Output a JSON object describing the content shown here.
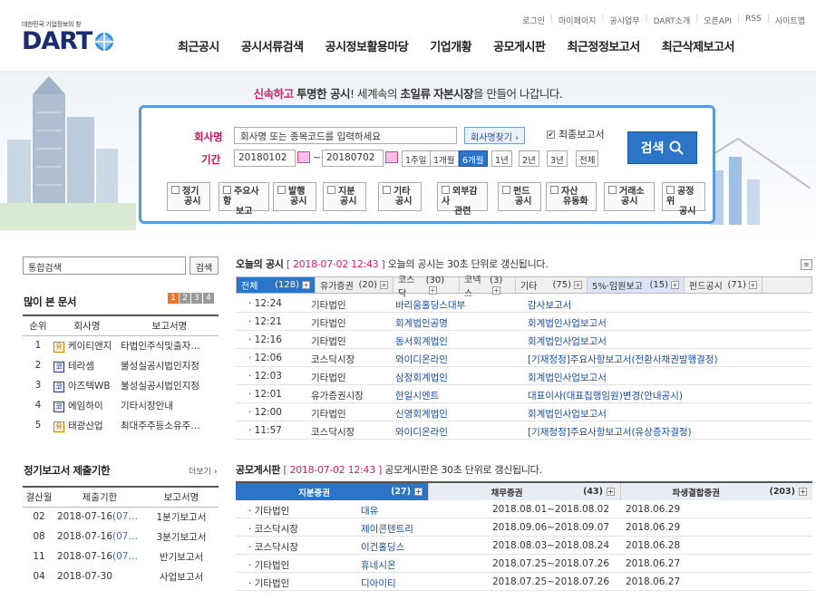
{
  "util_nav": [
    "로그인",
    "마이페이지",
    "공시업무",
    "DART소개",
    "오픈API",
    "RSS",
    "사이트맵"
  ],
  "logo": {
    "tagline": "대한민국 기업정보의 창",
    "word": "DART"
  },
  "gnb": [
    "최근공시",
    "공시서류검색",
    "공시정보활용마당",
    "기업개황",
    "공모게시판",
    "최근정정보고서",
    "최근삭제보고서"
  ],
  "slogan": {
    "p1": "신속하고",
    "p2": "투명한 공시",
    "p3": "! 세계속의",
    "p4": "초일류",
    "p5": "자본시장",
    "p6": "을 만들어 나갑니다."
  },
  "search": {
    "corp_label": "회사명",
    "corp_placeholder": "회사명 또는 종목코드를 입력하세요",
    "corp_find": "회사명찾기 ›",
    "final_report": "최종보고서",
    "period_label": "기간",
    "date_from": "20180102",
    "tilde": "~",
    "date_to": "20180702",
    "periods": [
      "1주일",
      "1개월",
      "6개월",
      "1년",
      "2년",
      "3년",
      "전체"
    ],
    "active_period": "6개월",
    "button": "검색",
    "types": [
      "정기\n공시",
      "주요사항\n보고",
      "발행\n공시",
      "지분\n공시",
      "기타\n공시",
      "외부감사\n관련",
      "펀드\n공시",
      "자산\n유동화",
      "거래소\n공시",
      "공정위\n공시"
    ]
  },
  "left": {
    "search_placeholder": "통합검색",
    "search_btn": "검색",
    "popular_title": "많이 본 문서",
    "pages": [
      "1",
      "2",
      "3",
      "4"
    ],
    "popular_headers": [
      "순위",
      "회사명",
      "보고서명"
    ],
    "popular": [
      {
        "rank": "1",
        "mk": "유",
        "company": "케이티앤지",
        "report": "타법인주식및출자…"
      },
      {
        "rank": "2",
        "mk": "코",
        "company": "테라셈",
        "report": "불성실공시법인지정"
      },
      {
        "rank": "3",
        "mk": "코",
        "company": "아즈텍WB",
        "report": "불성실공시법인지정"
      },
      {
        "rank": "4",
        "mk": "코",
        "company": "에임하이",
        "report": "기타시장안내"
      },
      {
        "rank": "5",
        "mk": "유",
        "company": "태광산업",
        "report": "최대주주등소유주…"
      }
    ],
    "deadline_title": "정기보고서 제출기한",
    "more": "더보기",
    "deadline_headers": [
      "결산월",
      "제출기한",
      "보고서명"
    ],
    "deadlines": [
      {
        "month": "02",
        "date": "2018-07-16",
        "extra": "(07…",
        "report": "1분기보고서"
      },
      {
        "month": "08",
        "date": "2018-07-16",
        "extra": "(07…",
        "report": "3분기보고서"
      },
      {
        "month": "11",
        "date": "2018-07-16",
        "extra": "(07…",
        "report": "반기보고서"
      },
      {
        "month": "04",
        "date": "2018-07-30",
        "extra": "",
        "report": "사업보고서"
      }
    ]
  },
  "today": {
    "title": "오늘의 공시",
    "stamp": "[ 2018-07-02 12:43 ]",
    "note": "오늘의 공시는 30초 단위로 갱신됩니다.",
    "tabs": [
      {
        "label": "전체",
        "count": "(128)"
      },
      {
        "label": "유가증권",
        "count": "(20)"
      },
      {
        "label": "코스닥",
        "count": "(30)"
      },
      {
        "label": "코넥스",
        "count": "(3)"
      },
      {
        "label": "기타",
        "count": "(75)"
      },
      {
        "label": "5%·임원보고",
        "count": "(15)"
      },
      {
        "label": "펀드공시",
        "count": "(71)"
      }
    ],
    "rows": [
      {
        "time": "· 12:24",
        "market": "기타법인",
        "company": "바리움홀딩스대부",
        "report": "감사보고서"
      },
      {
        "time": "· 12:21",
        "market": "기타법인",
        "company": "회계법인공명",
        "report": "회계법인사업보고서"
      },
      {
        "time": "· 12:16",
        "market": "기타법인",
        "company": "동서회계법인",
        "report": "회계법인사업보고서"
      },
      {
        "time": "· 12:06",
        "market": "코스닥시장",
        "company": "와이디온라인",
        "report": "[기재정정]주요사항보고서(전환사채권발행결정)"
      },
      {
        "time": "· 12:03",
        "market": "기타법인",
        "company": "삼정회계법인",
        "report": "회계법인사업보고서"
      },
      {
        "time": "· 12:01",
        "market": "유가증권시장",
        "company": "한일시멘트",
        "report": "대표이사(대표집행임원)변경(안내공시)"
      },
      {
        "time": "· 12:00",
        "market": "기타법인",
        "company": "신영회계법인",
        "report": "회계법인사업보고서"
      },
      {
        "time": "· 11:57",
        "market": "코스닥시장",
        "company": "와이디온라인",
        "report": "[기재정정]주요사항보고서(유상증자결정)"
      }
    ]
  },
  "board": {
    "title": "공모게시판",
    "stamp": "[ 2018-07-02 12:43 ]",
    "note": "공모게시판은 30초 단위로 갱신됩니다.",
    "heads": [
      {
        "label": "지분증권",
        "count": "(27)"
      },
      {
        "label": "채무증권",
        "count": "(43)"
      },
      {
        "label": "파생결합증권",
        "count": "(203)"
      }
    ],
    "rows": [
      {
        "market": "· 기타법인",
        "company": "대유",
        "period": "2018.08.01~2018.08.02",
        "date": "2018.06.29"
      },
      {
        "market": "· 코스닥시장",
        "company": "제이콘텐트리",
        "period": "2018.09.06~2018.09.07",
        "date": "2018.06.29"
      },
      {
        "market": "· 코스닥시장",
        "company": "이건홀딩스",
        "period": "2018.08.03~2018.08.24",
        "date": "2018.06.28"
      },
      {
        "market": "· 기타법인",
        "company": "휴네시온",
        "period": "2018.07.25~2018.07.26",
        "date": "2018.06.27"
      },
      {
        "market": "· 기타법인",
        "company": "디아이티",
        "period": "2018.07.25~2018.07.26",
        "date": "2018.06.27"
      }
    ]
  }
}
